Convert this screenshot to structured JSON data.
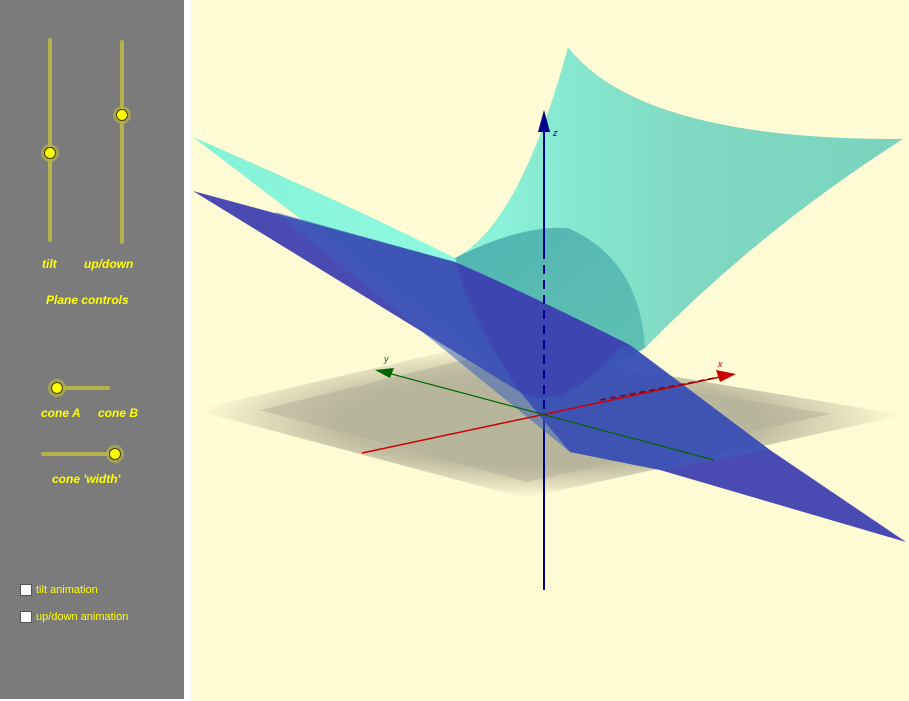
{
  "sliders": {
    "tilt": {
      "label": "tilt",
      "value": 0.43
    },
    "updown": {
      "label": "up/down",
      "value": 0.62
    },
    "cone": {
      "label_a": "cone A",
      "label_b": "cone B",
      "value": 0.0
    },
    "width": {
      "label": "cone 'width'",
      "value": 1.0
    }
  },
  "plane_controls_label": "Plane controls",
  "checkboxes": [
    {
      "label": "tilt animation",
      "checked": false
    },
    {
      "label": "up/down animation",
      "checked": false
    }
  ],
  "axes": {
    "x": "x",
    "y": "y",
    "z": "z"
  },
  "colors": {
    "background": "#fffbd4",
    "sidebar": "#7b7b7b",
    "label": "#ffff00",
    "cone": "#7ee6cf",
    "plane": "#3a3aa8",
    "x_axis": "#cc0000",
    "y_axis": "#006600",
    "z_axis": "#00008b"
  }
}
